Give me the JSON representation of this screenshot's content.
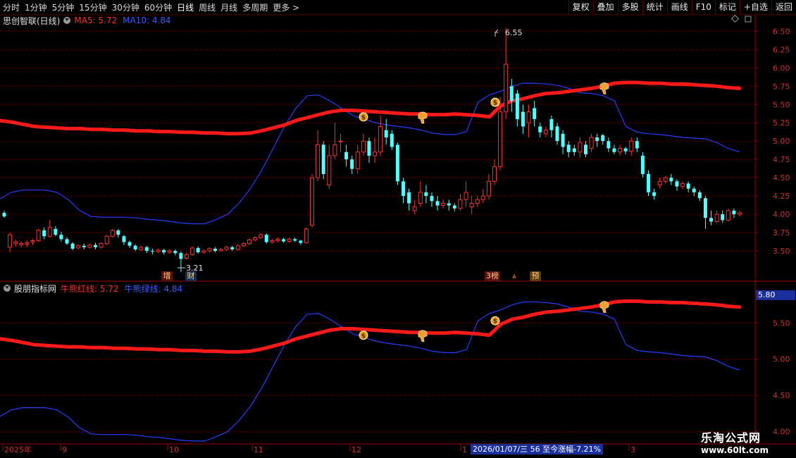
{
  "toolbar": {
    "periods": [
      "分时",
      "1分钟",
      "5分钟",
      "15分钟",
      "30分钟",
      "60分钟",
      "日线",
      "周线",
      "月线",
      "多周期",
      "更多 >"
    ],
    "active_period": "日线",
    "right_buttons": [
      "复权",
      "叠加",
      "多股",
      "统计",
      "画线",
      "F10",
      "标记",
      "+自选",
      "返回"
    ]
  },
  "main_panel": {
    "stock_name": "思创智联(日线)",
    "ma5_label": "MA5: 5.72",
    "ma10_label": "MA10: 4.84",
    "high_label": "6.55",
    "low_label": "3.21",
    "y_ticks": [
      "6.50",
      "6.25",
      "6.00",
      "5.75",
      "5.50",
      "5.25",
      "5.00",
      "4.75",
      "4.50",
      "4.25",
      "4.00",
      "3.75",
      "3.50"
    ],
    "event_markers": [
      "增",
      "财",
      "3榜",
      "⩓",
      "预"
    ]
  },
  "sub_panel": {
    "name": "股朋指标网",
    "red_label": "牛熊红线: 5.72",
    "blue_label": "牛熊绿线: 4.84",
    "y_ticks": [
      "5.50",
      "5.00",
      "4.50",
      "4.00"
    ],
    "cursor_value": "5.80"
  },
  "time_axis": {
    "labels": [
      "2025年",
      "9",
      "10",
      "11",
      "12",
      "1",
      "3"
    ],
    "range_info": "2026/01/07/三 56 至今涨幅-7.21%"
  },
  "watermark": {
    "title": "乐淘公式网",
    "url": "www.60lt.com"
  },
  "colors": {
    "up": "#ff3030",
    "down": "#54ffff",
    "red_line": "#ff1a1a",
    "blue_line": "#2a3cff",
    "grid": "#8b0000"
  },
  "chart_data": {
    "type": "candlestick",
    "price_range": [
      3.25,
      6.6
    ],
    "indicator_range": [
      3.85,
      5.95
    ],
    "candles": [
      [
        4.02,
        3.97,
        4.05,
        3.95
      ],
      [
        3.55,
        3.72,
        3.75,
        3.48
      ],
      [
        3.6,
        3.62,
        3.65,
        3.56
      ],
      [
        3.58,
        3.6,
        3.63,
        3.55
      ],
      [
        3.59,
        3.61,
        3.64,
        3.55
      ],
      [
        3.62,
        3.64,
        3.66,
        3.58
      ],
      [
        3.64,
        3.78,
        3.8,
        3.62
      ],
      [
        3.78,
        3.7,
        3.82,
        3.66
      ],
      [
        3.7,
        3.82,
        3.92,
        3.68
      ],
      [
        3.8,
        3.72,
        3.84,
        3.7
      ],
      [
        3.72,
        3.66,
        3.76,
        3.63
      ],
      [
        3.66,
        3.6,
        3.69,
        3.58
      ],
      [
        3.6,
        3.53,
        3.62,
        3.51
      ],
      [
        3.54,
        3.57,
        3.59,
        3.52
      ],
      [
        3.57,
        3.55,
        3.6,
        3.52
      ],
      [
        3.55,
        3.58,
        3.6,
        3.53
      ],
      [
        3.58,
        3.55,
        3.61,
        3.52
      ],
      [
        3.55,
        3.6,
        3.62,
        3.53
      ],
      [
        3.6,
        3.7,
        3.72,
        3.58
      ],
      [
        3.7,
        3.78,
        3.8,
        3.68
      ],
      [
        3.78,
        3.72,
        3.8,
        3.68
      ],
      [
        3.7,
        3.62,
        3.72,
        3.58
      ],
      [
        3.62,
        3.57,
        3.64,
        3.54
      ],
      [
        3.57,
        3.52,
        3.59,
        3.5
      ],
      [
        3.52,
        3.55,
        3.57,
        3.5
      ],
      [
        3.55,
        3.5,
        3.57,
        3.47
      ],
      [
        3.5,
        3.49,
        3.53,
        3.45
      ],
      [
        3.49,
        3.51,
        3.53,
        3.47
      ],
      [
        3.51,
        3.48,
        3.53,
        3.45
      ],
      [
        3.48,
        3.5,
        3.52,
        3.46
      ],
      [
        3.5,
        3.47,
        3.52,
        3.44
      ],
      [
        3.47,
        3.39,
        3.49,
        3.21
      ],
      [
        3.4,
        3.45,
        3.48,
        3.38
      ],
      [
        3.45,
        3.54,
        3.56,
        3.43
      ],
      [
        3.54,
        3.48,
        3.56,
        3.46
      ],
      [
        3.48,
        3.5,
        3.52,
        3.46
      ],
      [
        3.5,
        3.53,
        3.55,
        3.48
      ],
      [
        3.53,
        3.5,
        3.55,
        3.48
      ],
      [
        3.5,
        3.52,
        3.54,
        3.49
      ],
      [
        3.52,
        3.55,
        3.57,
        3.5
      ],
      [
        3.55,
        3.52,
        3.57,
        3.5
      ],
      [
        3.52,
        3.57,
        3.59,
        3.5
      ],
      [
        3.57,
        3.6,
        3.62,
        3.55
      ],
      [
        3.6,
        3.65,
        3.67,
        3.58
      ],
      [
        3.65,
        3.68,
        3.7,
        3.63
      ],
      [
        3.68,
        3.72,
        3.74,
        3.66
      ],
      [
        3.72,
        3.62,
        3.74,
        3.6
      ],
      [
        3.62,
        3.64,
        3.66,
        3.6
      ],
      [
        3.64,
        3.66,
        3.68,
        3.62
      ],
      [
        3.66,
        3.63,
        3.68,
        3.61
      ],
      [
        3.63,
        3.66,
        3.68,
        3.61
      ],
      [
        3.66,
        3.64,
        3.68,
        3.62
      ],
      [
        3.64,
        3.61,
        3.65,
        3.58
      ],
      [
        3.61,
        3.8,
        3.82,
        3.6
      ],
      [
        3.85,
        4.5,
        4.55,
        3.82
      ],
      [
        4.5,
        4.95,
        5.15,
        4.45
      ],
      [
        4.95,
        4.55,
        5.0,
        4.48
      ],
      [
        4.4,
        4.8,
        4.95,
        4.35
      ],
      [
        4.8,
        4.95,
        5.25,
        4.75
      ],
      [
        5.0,
        5.0,
        5.1,
        4.85
      ],
      [
        4.85,
        4.75,
        4.95,
        4.65
      ],
      [
        4.75,
        4.62,
        4.8,
        4.55
      ],
      [
        4.62,
        4.85,
        4.95,
        4.55
      ],
      [
        4.85,
        5.0,
        5.1,
        4.8
      ],
      [
        5.0,
        4.8,
        5.05,
        4.7
      ],
      [
        4.8,
        4.85,
        5.05,
        4.7
      ],
      [
        4.85,
        5.2,
        5.35,
        4.8
      ],
      [
        5.15,
        5.05,
        5.3,
        4.95
      ],
      [
        5.1,
        4.92,
        5.15,
        4.88
      ],
      [
        4.95,
        4.45,
        4.98,
        4.4
      ],
      [
        4.45,
        4.25,
        4.5,
        4.15
      ],
      [
        4.3,
        4.15,
        4.35,
        4.05
      ],
      [
        4.05,
        4.1,
        4.2,
        4.0
      ],
      [
        4.15,
        4.3,
        4.45,
        4.1
      ],
      [
        4.3,
        4.25,
        4.4,
        4.15
      ],
      [
        4.25,
        4.18,
        4.3,
        4.1
      ],
      [
        4.18,
        4.12,
        4.25,
        4.05
      ],
      [
        4.12,
        4.15,
        4.2,
        4.08
      ],
      [
        4.15,
        4.12,
        4.2,
        4.05
      ],
      [
        4.12,
        4.08,
        4.15,
        4.04
      ],
      [
        4.08,
        4.2,
        4.28,
        4.05
      ],
      [
        4.2,
        4.3,
        4.45,
        4.1
      ],
      [
        4.1,
        4.15,
        4.25,
        4.0
      ],
      [
        4.15,
        4.2,
        4.25,
        4.1
      ],
      [
        4.2,
        4.25,
        4.35,
        4.15
      ],
      [
        4.25,
        4.45,
        4.55,
        4.2
      ],
      [
        4.45,
        4.65,
        4.75,
        4.4
      ],
      [
        4.65,
        5.4,
        5.6,
        4.6
      ],
      [
        5.4,
        6.05,
        6.55,
        5.3
      ],
      [
        5.75,
        5.55,
        5.85,
        5.4
      ],
      [
        5.65,
        5.3,
        5.7,
        5.2
      ],
      [
        5.4,
        5.2,
        5.5,
        5.1
      ],
      [
        5.25,
        5.4,
        5.5,
        5.05
      ],
      [
        5.45,
        5.3,
        5.55,
        5.2
      ],
      [
        5.2,
        5.12,
        5.25,
        5.05
      ],
      [
        5.1,
        5.15,
        5.2,
        5.05
      ],
      [
        5.3,
        5.15,
        5.35,
        5.05
      ],
      [
        5.2,
        5.0,
        5.25,
        4.95
      ],
      [
        5.1,
        4.92,
        5.15,
        4.82
      ],
      [
        4.95,
        4.85,
        5.0,
        4.78
      ],
      [
        4.9,
        4.85,
        4.95,
        4.8
      ],
      [
        4.85,
        4.98,
        5.05,
        4.78
      ],
      [
        4.95,
        4.82,
        5.0,
        4.78
      ],
      [
        4.9,
        5.05,
        5.1,
        4.85
      ],
      [
        5.05,
        5.0,
        5.1,
        4.92
      ],
      [
        5.08,
        5.0,
        5.1,
        4.95
      ],
      [
        5.0,
        4.9,
        5.05,
        4.85
      ],
      [
        4.9,
        4.85,
        4.95,
        4.82
      ],
      [
        4.85,
        4.9,
        4.95,
        4.8
      ],
      [
        4.9,
        4.86,
        4.92,
        4.82
      ],
      [
        4.86,
        5.0,
        5.05,
        4.8
      ],
      [
        5.0,
        4.9,
        5.05,
        4.85
      ],
      [
        4.8,
        4.55,
        4.85,
        4.5
      ],
      [
        4.55,
        4.3,
        4.6,
        4.25
      ],
      [
        4.3,
        4.25,
        4.35,
        4.2
      ],
      [
        4.4,
        4.45,
        4.5,
        4.35
      ],
      [
        4.45,
        4.5,
        4.52,
        4.42
      ],
      [
        4.5,
        4.45,
        4.55,
        4.4
      ],
      [
        4.45,
        4.38,
        4.48,
        4.32
      ],
      [
        4.38,
        4.42,
        4.45,
        4.34
      ],
      [
        4.42,
        4.35,
        4.45,
        4.3
      ],
      [
        4.35,
        4.3,
        4.38,
        4.25
      ],
      [
        4.3,
        4.22,
        4.33,
        4.18
      ],
      [
        4.22,
        3.95,
        4.25,
        3.8
      ],
      [
        3.95,
        3.9,
        4.05,
        3.85
      ],
      [
        3.9,
        4.0,
        4.05,
        3.88
      ],
      [
        4.0,
        3.92,
        4.05,
        3.88
      ],
      [
        3.92,
        4.05,
        4.08,
        3.9
      ],
      [
        4.05,
        4.0,
        4.08,
        3.95
      ],
      [
        4.0,
        4.02,
        4.05,
        3.97
      ]
    ],
    "red_line": [
      5.28,
      5.26,
      5.23,
      5.2,
      5.19,
      5.18,
      5.17,
      5.17,
      5.16,
      5.16,
      5.15,
      5.15,
      5.14,
      5.14,
      5.13,
      5.13,
      5.12,
      5.12,
      5.11,
      5.11,
      5.1,
      5.1,
      5.11,
      5.14,
      5.18,
      5.22,
      5.28,
      5.32,
      5.36,
      5.4,
      5.42,
      5.42,
      5.41,
      5.4,
      5.39,
      5.38,
      5.37,
      5.37,
      5.36,
      5.36,
      5.37,
      5.36,
      5.35,
      5.33,
      5.48,
      5.55,
      5.58,
      5.62,
      5.65,
      5.66,
      5.68,
      5.7,
      5.72,
      5.75,
      5.79,
      5.8,
      5.8,
      5.79,
      5.79,
      5.78,
      5.78,
      5.77,
      5.76,
      5.75,
      5.73,
      5.72
    ],
    "blue_line": [
      4.21,
      4.3,
      4.33,
      4.33,
      4.33,
      4.3,
      4.2,
      4.05,
      3.97,
      3.96,
      3.96,
      3.96,
      3.95,
      3.93,
      3.92,
      3.9,
      3.88,
      3.87,
      3.87,
      3.93,
      4.0,
      4.15,
      4.35,
      4.6,
      4.9,
      5.2,
      5.45,
      5.62,
      5.63,
      5.55,
      5.45,
      5.35,
      5.3,
      5.25,
      5.22,
      5.2,
      5.18,
      5.15,
      5.11,
      5.09,
      5.09,
      5.13,
      5.53,
      5.63,
      5.68,
      5.75,
      5.79,
      5.79,
      5.78,
      5.76,
      5.72,
      5.66,
      5.65,
      5.62,
      5.55,
      5.2,
      5.12,
      5.1,
      5.09,
      5.07,
      5.05,
      5.04,
      5.03,
      4.98,
      4.9,
      4.85
    ],
    "signal_coins": [
      [
        516,
        5.33
      ],
      [
        703,
        5.53
      ]
    ],
    "signal_hands": [
      [
        600,
        5.33
      ],
      [
        858,
        5.73
      ]
    ]
  }
}
